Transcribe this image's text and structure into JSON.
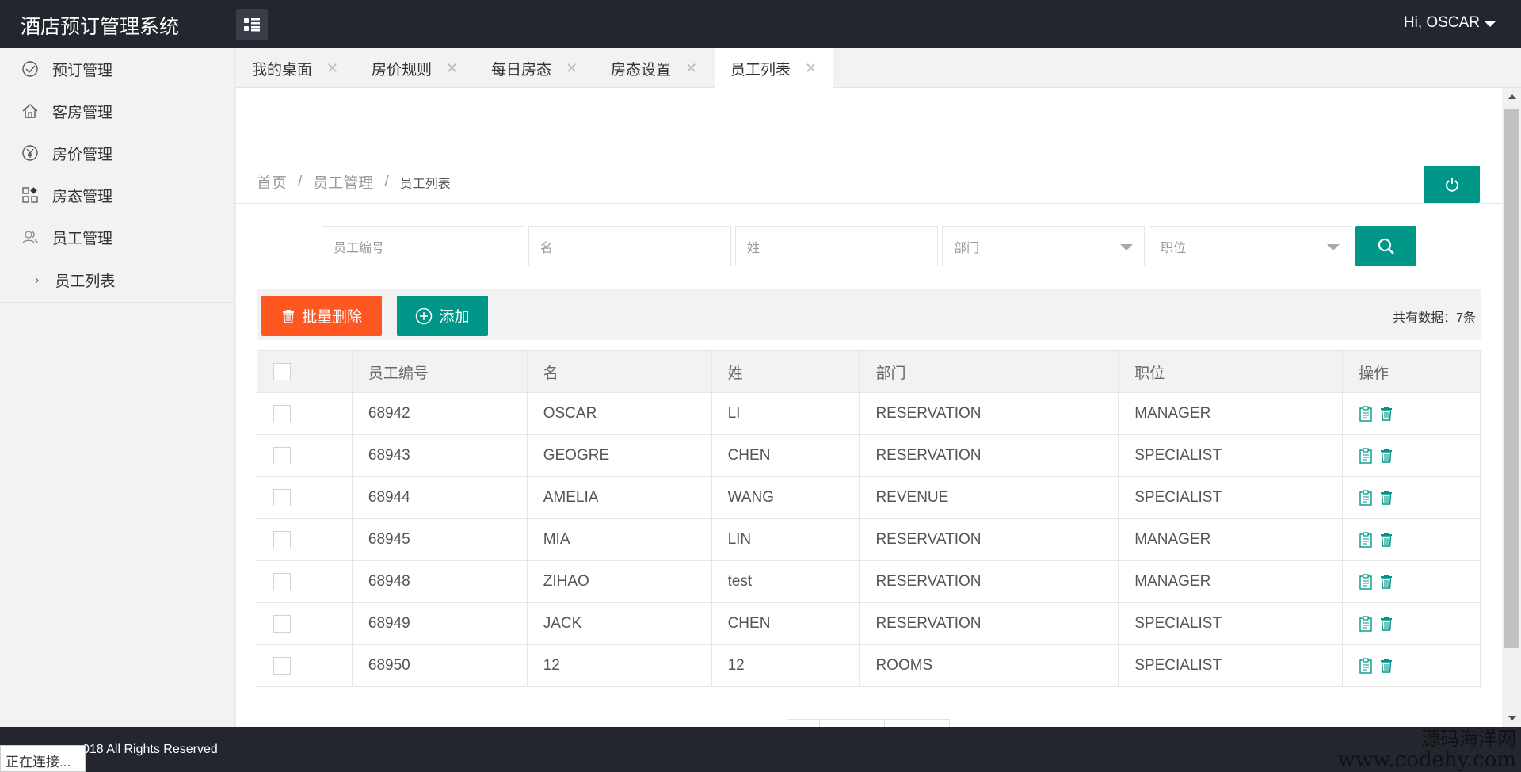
{
  "app": {
    "title": "酒店预订管理系统",
    "user_greeting": "Hi, OSCAR"
  },
  "sidebar": {
    "items": [
      {
        "label": "预订管理",
        "icon": "check-circle-icon"
      },
      {
        "label": "客房管理",
        "icon": "home-icon"
      },
      {
        "label": "房价管理",
        "icon": "yen-icon"
      },
      {
        "label": "房态管理",
        "icon": "app-grid-icon"
      },
      {
        "label": "员工管理",
        "icon": "users-icon"
      }
    ],
    "sub_item": "员工列表"
  },
  "tabs": [
    {
      "label": "我的桌面"
    },
    {
      "label": "房价规则"
    },
    {
      "label": "每日房态"
    },
    {
      "label": "房态设置"
    },
    {
      "label": "员工列表",
      "active": true
    }
  ],
  "breadcrumb": {
    "home": "首页",
    "section": "员工管理",
    "current": "员工列表"
  },
  "search": {
    "id_placeholder": "员工编号",
    "first_name_placeholder": "名",
    "last_name_placeholder": "姓",
    "dept_placeholder": "部门",
    "position_placeholder": "职位"
  },
  "toolbar": {
    "batch_delete": "批量删除",
    "add": "添加",
    "total": "共有数据：7条"
  },
  "table": {
    "headers": [
      "员工编号",
      "名",
      "姓",
      "部门",
      "职位",
      "操作"
    ],
    "rows": [
      [
        "68942",
        "OSCAR",
        "LI",
        "RESERVATION",
        "MANAGER"
      ],
      [
        "68943",
        "GEOGRE",
        "CHEN",
        "RESERVATION",
        "SPECIALIST"
      ],
      [
        "68944",
        "AMELIA",
        "WANG",
        "REVENUE",
        "SPECIALIST"
      ],
      [
        "68945",
        "MIA",
        "LIN",
        "RESERVATION",
        "MANAGER"
      ],
      [
        "68948",
        "ZIHAO",
        "test",
        "RESERVATION",
        "MANAGER"
      ],
      [
        "68949",
        "JACK",
        "CHEN",
        "RESERVATION",
        "SPECIALIST"
      ],
      [
        "68950",
        "12",
        "12",
        "ROOMS",
        "SPECIALIST"
      ]
    ]
  },
  "footer": {
    "copyright": "018 All Rights Reserved",
    "status": "正在连接..."
  },
  "watermark": {
    "line1": "源码海洋网",
    "line2": "www.codehy.com"
  },
  "colors": {
    "primary": "#009688",
    "danger": "#ff5722",
    "header": "#23262e"
  }
}
